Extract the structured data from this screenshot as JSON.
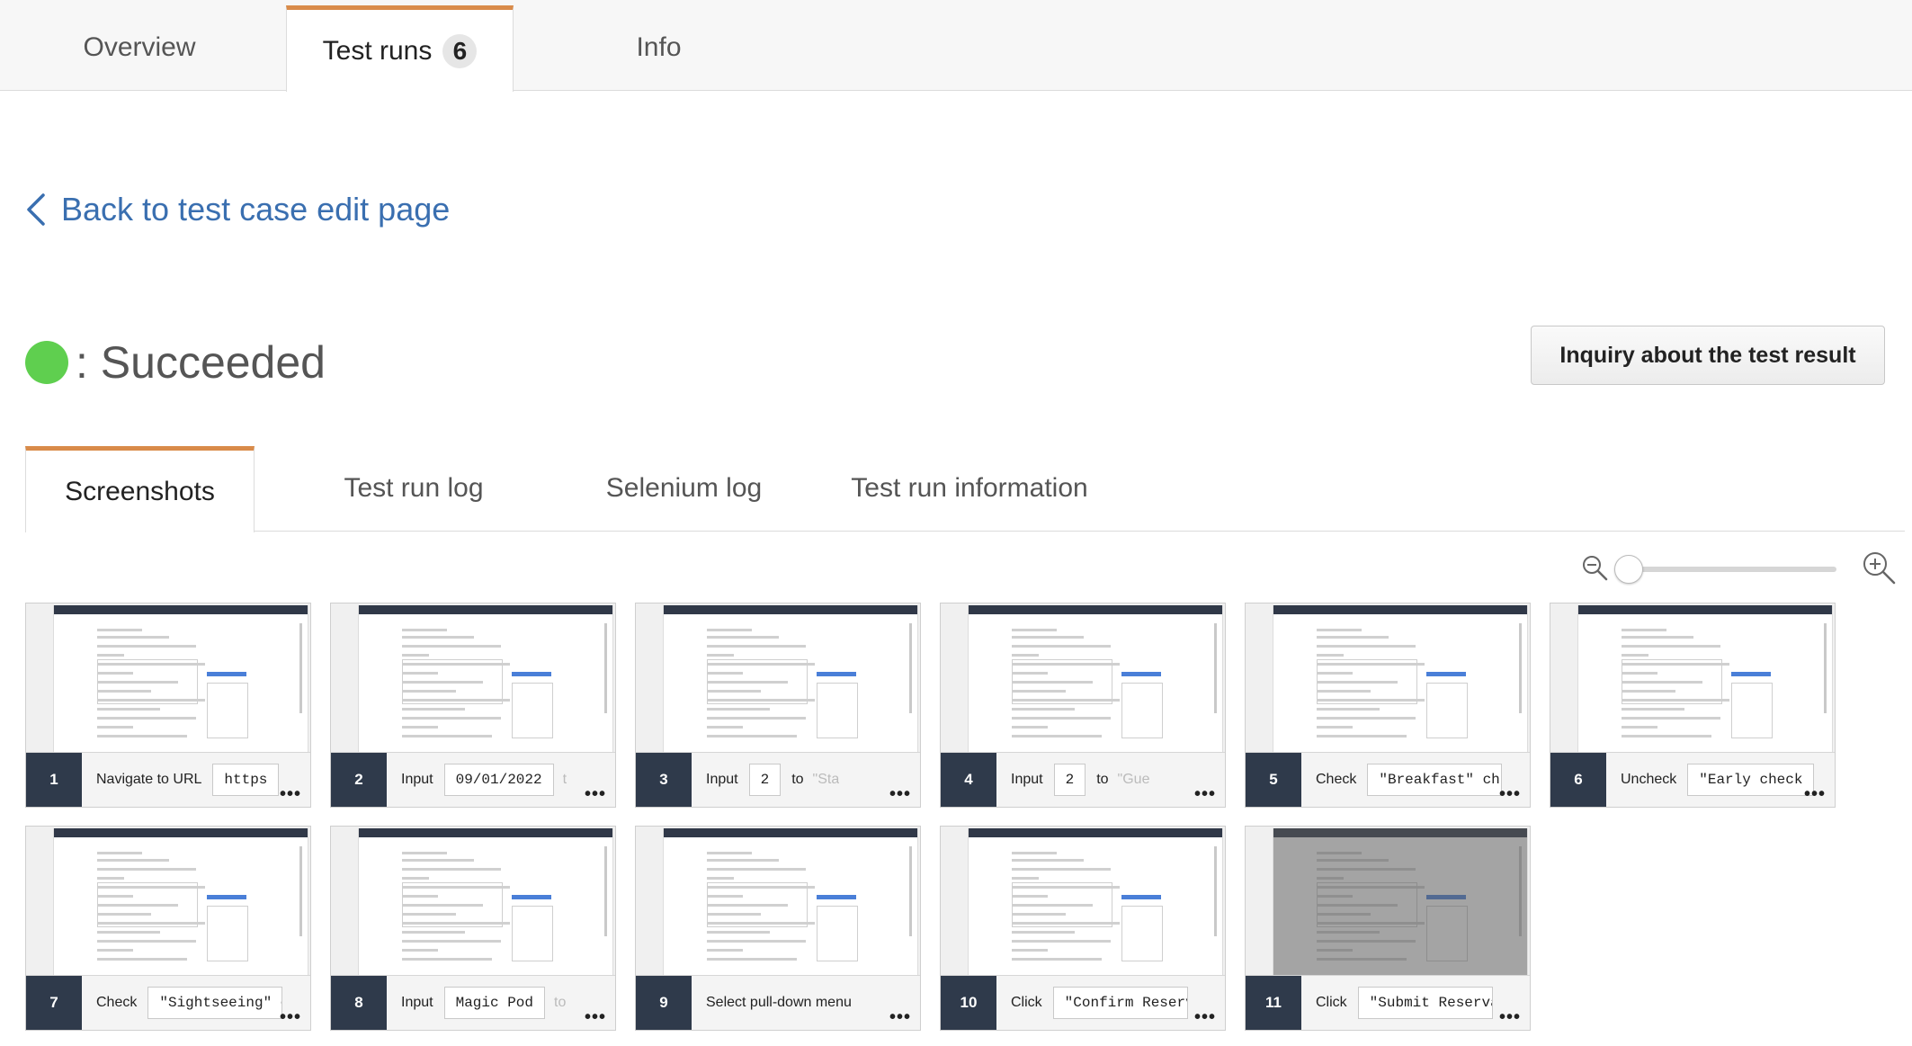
{
  "tabs": [
    {
      "label": "Overview"
    },
    {
      "label": "Test runs",
      "badge": "6"
    },
    {
      "label": "Info"
    }
  ],
  "back_link": "Back to test case edit page",
  "status": {
    "text": ": Succeeded",
    "color": "#5fcf4f"
  },
  "inquiry_button": "Inquiry about the test result",
  "subtabs": [
    "Screenshots",
    "Test run log",
    "Selenium log",
    "Test run information"
  ],
  "accent_color": "#d98b4a",
  "steps": [
    {
      "num": "1",
      "action": "Navigate to URL",
      "chip": "https",
      "extra": ""
    },
    {
      "num": "2",
      "action": "Input",
      "chip": "09/01/2022",
      "extra": "t"
    },
    {
      "num": "3",
      "action": "Input",
      "chip": "2",
      "to": "to",
      "extra": "\"Sta"
    },
    {
      "num": "4",
      "action": "Input",
      "chip": "2",
      "to": "to",
      "extra": "\"Gue"
    },
    {
      "num": "5",
      "action": "Check",
      "chip": "\"Breakfast\" ch",
      "extra": ""
    },
    {
      "num": "6",
      "action": "Uncheck",
      "chip": "\"Early check",
      "extra": ""
    },
    {
      "num": "7",
      "action": "Check",
      "chip": "\"Sightseeing\" c",
      "extra": ""
    },
    {
      "num": "8",
      "action": "Input",
      "chip": "Magic Pod",
      "extra": "to"
    },
    {
      "num": "9",
      "action": "Select pull-down menu",
      "chip": "",
      "extra": ""
    },
    {
      "num": "10",
      "action": "Click",
      "chip": "\"Confirm Reserv",
      "extra": ""
    },
    {
      "num": "11",
      "action": "Click",
      "chip": "\"Submit Reserva",
      "extra": ""
    }
  ]
}
